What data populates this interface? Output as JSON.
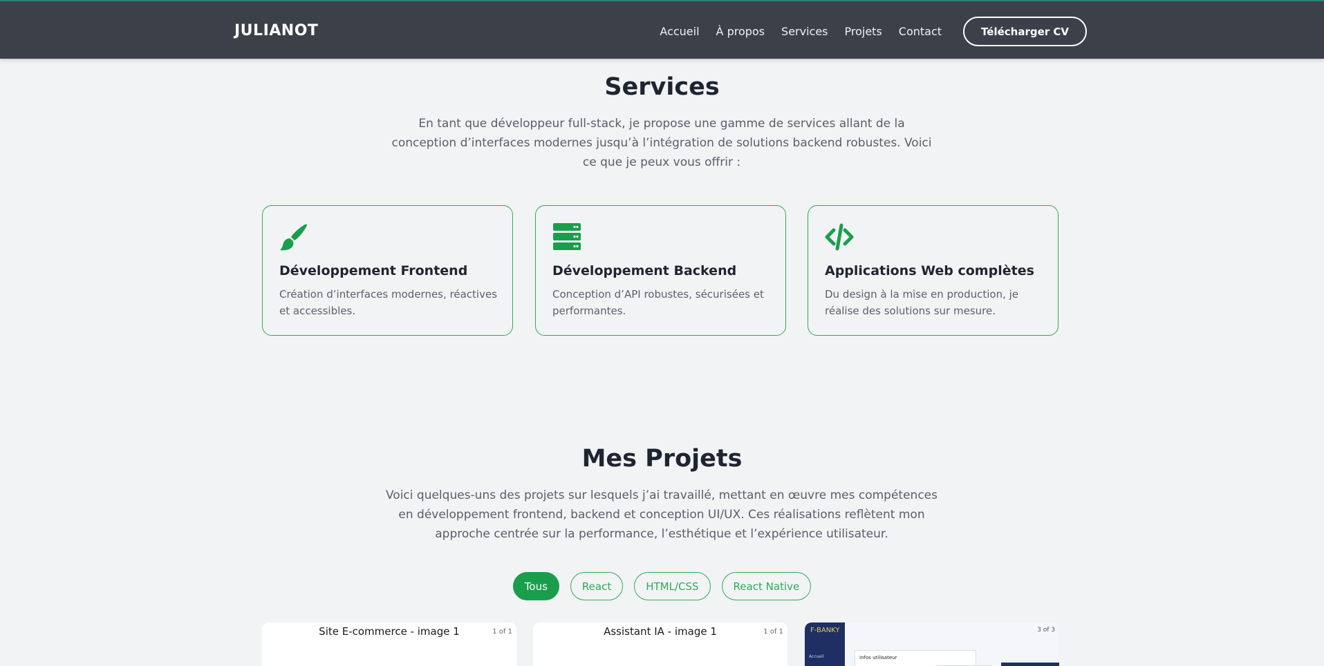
{
  "header": {
    "logo": "JULIANOT",
    "nav": [
      "Accueil",
      "À propos",
      "Services",
      "Projets",
      "Contact"
    ],
    "cv_button": "Télécharger CV"
  },
  "services": {
    "title": "Services",
    "intro": "En tant que développeur full-stack, je propose une gamme de services allant de la conception d’interfaces modernes jusqu’à l’intégration de solutions backend robustes. Voici ce que je peux vous offrir :",
    "items": [
      {
        "icon": "paintbrush-icon",
        "title": "Développement Frontend",
        "description": "Création d’interfaces modernes, réactives et accessibles."
      },
      {
        "icon": "server-icon",
        "title": "Développement Backend",
        "description": "Conception d’API robustes, sécurisées et performantes."
      },
      {
        "icon": "code-icon",
        "title": "Applications Web complètes",
        "description": "Du design à la mise en production, je réalise des solutions sur mesure."
      }
    ]
  },
  "projects": {
    "title": "Mes Projets",
    "intro": "Voici quelques-uns des projets sur lesquels j’ai travaillé, mettant en œuvre mes compétences en développement frontend, backend et conception UI/UX. Ces réalisations reflètent mon approche centrée sur la performance, l’esthétique et l’expérience utilisateur.",
    "filters": [
      "Tous",
      "React",
      "HTML/CSS",
      "React Native"
    ],
    "active_filter": "Tous",
    "cards": [
      {
        "caption": "Site E-commerce - image 1",
        "counter": "1 of 1"
      },
      {
        "caption": "Assistant IA - image 1",
        "counter": "1 of 1"
      },
      {
        "counter": "3 of 3",
        "screenshot": {
          "logo": "F-BANKY",
          "menu_item": "Accueil",
          "panel_label": "Infos utilisateur"
        }
      }
    ]
  },
  "colors": {
    "accent": "#1a9e4b",
    "header_bg": "#3c4049",
    "page_bg": "#f2f3f5"
  }
}
